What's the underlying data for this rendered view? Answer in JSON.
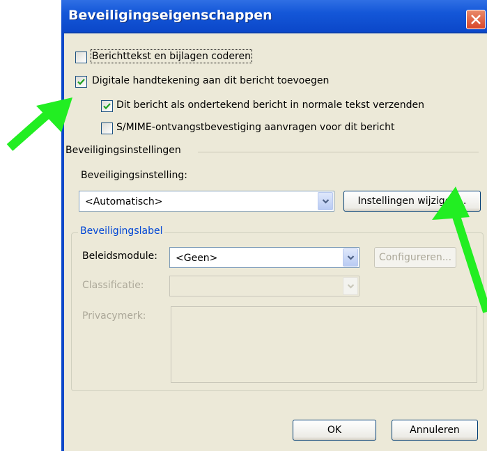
{
  "dialog": {
    "title": "Beveiligingseigenschappen"
  },
  "options": {
    "encrypt": {
      "label": "Berichttekst en bijlagen coderen",
      "checked": false
    },
    "sign": {
      "label": "Digitale handtekening aan dit bericht toevoegen",
      "checked": true
    },
    "clear_text": {
      "label": "Dit bericht als ondertekend bericht in normale tekst verzenden",
      "checked": true
    },
    "receipt": {
      "label": "S/MIME-ontvangstbevestiging aanvragen voor dit bericht",
      "checked": false
    }
  },
  "security_settings": {
    "section_title": "Beveiligingsinstellingen",
    "setting_label": "Beveiligingsinstelling:",
    "setting_value": "<Automatisch>",
    "change_button": "Instellingen wijzigen..."
  },
  "security_label": {
    "group_title": "Beveiligingslabel",
    "policy_label": "Beleidsmodule:",
    "policy_value": "<Geen>",
    "configure_button": "Configureren...",
    "classification_label": "Classificatie:",
    "classification_value": "",
    "privacy_label": "Privacymerk:",
    "privacy_value": ""
  },
  "footer": {
    "ok": "OK",
    "cancel": "Annuleren"
  },
  "colors": {
    "arrow": "#22ee22",
    "titlebar": "#1457d8",
    "dialog_bg": "#ece9d8"
  },
  "icons": [
    "close-icon",
    "checkmark-icon",
    "chevron-down-icon",
    "arrow-annotation"
  ]
}
